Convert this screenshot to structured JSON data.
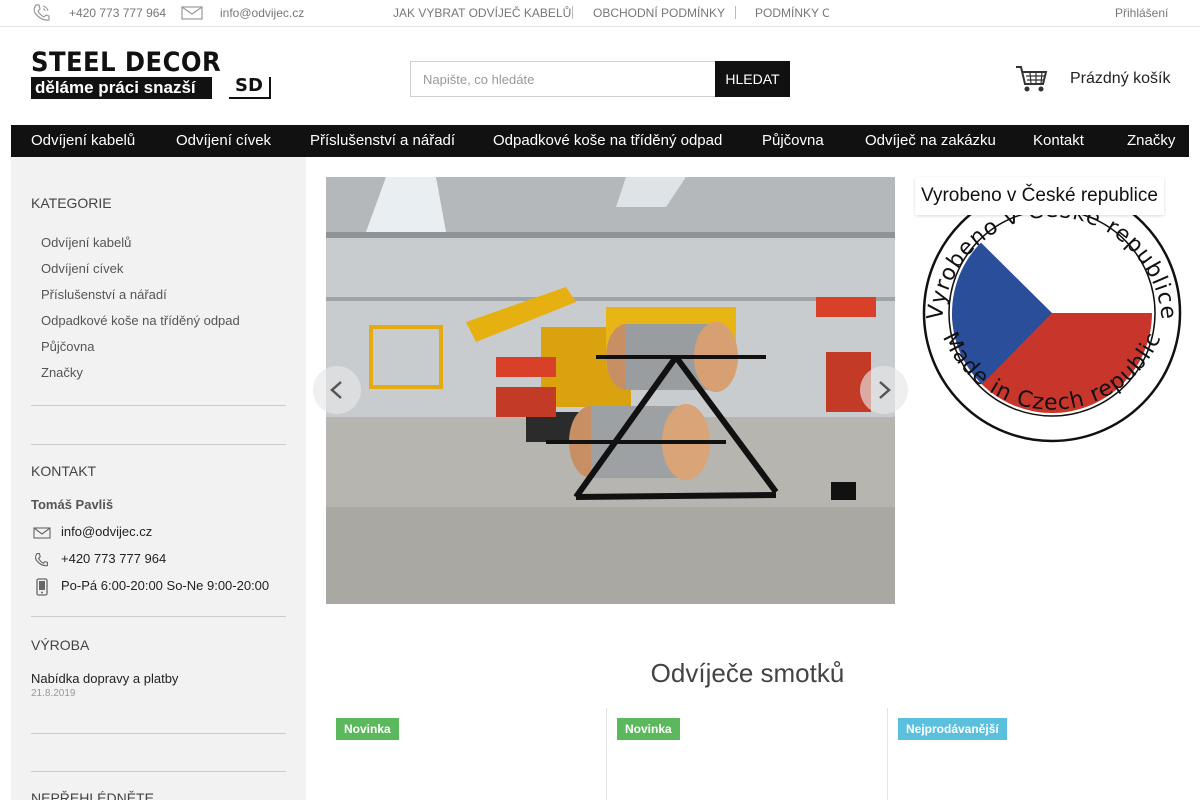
{
  "topbar": {
    "phone": "+420 773 777 964",
    "email": "info@odvijec.cz",
    "links": [
      "JAK VYBRAT ODVÍJEČ KABELŮ",
      "OBCHODNÍ PODMÍNKY",
      "PODMÍNKY OC"
    ],
    "login": "Přihlášení"
  },
  "header": {
    "logo_line1": "STEEL DECOR",
    "logo_line2": "děláme práci snazší",
    "logo_mark": "SD",
    "search_placeholder": "Napište, co hledáte",
    "search_button": "HLEDAT",
    "cart_label": "Prázdný košík"
  },
  "nav": [
    "Odvíjení kabelů",
    "Odvíjení cívek",
    "Příslušenství a nářadí",
    "Odpadkové koše na tříděný odpad",
    "Půjčovna",
    "Odvíječ na zakázku",
    "Kontakt",
    "Značky"
  ],
  "sidebar": {
    "categories_title": "KATEGORIE",
    "categories": [
      "Odvíjení kabelů",
      "Odvíjení cívek",
      "Příslušenství a nářadí",
      "Odpadkové koše na tříděný odpad",
      "Půjčovna",
      "Značky"
    ],
    "contact_title": "KONTAKT",
    "contact_person": "Tomáš Pavliš",
    "contact_email": "info@odvijec.cz",
    "contact_phone": "+420 773 777 964",
    "contact_hours": "Po-Pá 6:00-20:00 So-Ne 9:00-20:00",
    "news_title": "VÝROBA",
    "news_item_title": "Nabídka dopravy a platby",
    "news_item_date": "21.8.2019",
    "next_title": "NEPŘEHLÉDNĚTE"
  },
  "made_in": {
    "caption": "Vyrobeno v České republice",
    "ring_top": "Vyrobeno v České republice",
    "ring_bottom": "Made in Czech republic"
  },
  "section": {
    "title": "Odvíječe smotků"
  },
  "products": [
    {
      "badge": "Novinka",
      "badge_color": "#5cb85c"
    },
    {
      "badge": "Novinka",
      "badge_color": "#5cb85c"
    },
    {
      "badge": "Nejprodávanější",
      "badge_color": "#5bc0de"
    }
  ],
  "colors": {
    "nav_bg": "#111111",
    "flag_blue": "#2a4e9a",
    "flag_red": "#c8352b"
  }
}
